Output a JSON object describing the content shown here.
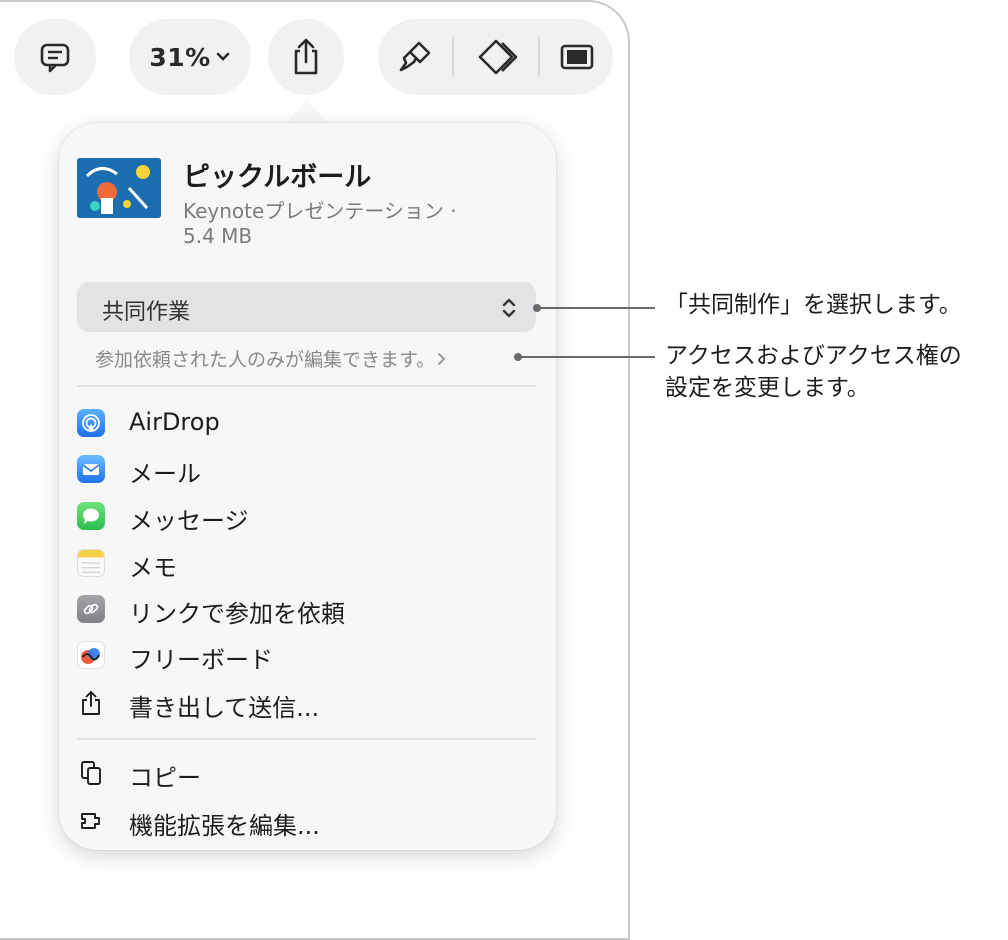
{
  "toolbar": {
    "zoom_label": "31%"
  },
  "popover": {
    "doc_title": "ピックルボール",
    "doc_kind": "Keynoteプレゼンテーション ·",
    "doc_size": "5.4 MB",
    "collab_mode": "共同作業",
    "access_note": "参加依頼された人のみが編集できます。",
    "share_items": [
      {
        "label": "AirDrop",
        "icon": "airdrop-icon",
        "color": "#2f7cf6"
      },
      {
        "label": "メール",
        "icon": "mail-icon",
        "color": "#2f8cf7"
      },
      {
        "label": "メッセージ",
        "icon": "messages-icon",
        "color": "#34c759"
      },
      {
        "label": "メモ",
        "icon": "notes-icon",
        "color": "#f6d046"
      },
      {
        "label": "リンクで参加を依頼",
        "icon": "link-icon",
        "color": "#8e8e93"
      },
      {
        "label": "フリーボード",
        "icon": "freeform-icon",
        "color": "#ffffff"
      },
      {
        "label": "書き出して送信...",
        "icon": "export-icon",
        "color": "#1d1d1f"
      }
    ],
    "extra_items": [
      {
        "label": "コピー",
        "icon": "copy-icon"
      },
      {
        "label": "機能拡張を編集...",
        "icon": "extensions-icon"
      }
    ]
  },
  "callouts": {
    "collab": "「共同制作」を選択します。",
    "access_line1": "アクセスおよびアクセス権の",
    "access_line2": "設定を変更します。"
  }
}
